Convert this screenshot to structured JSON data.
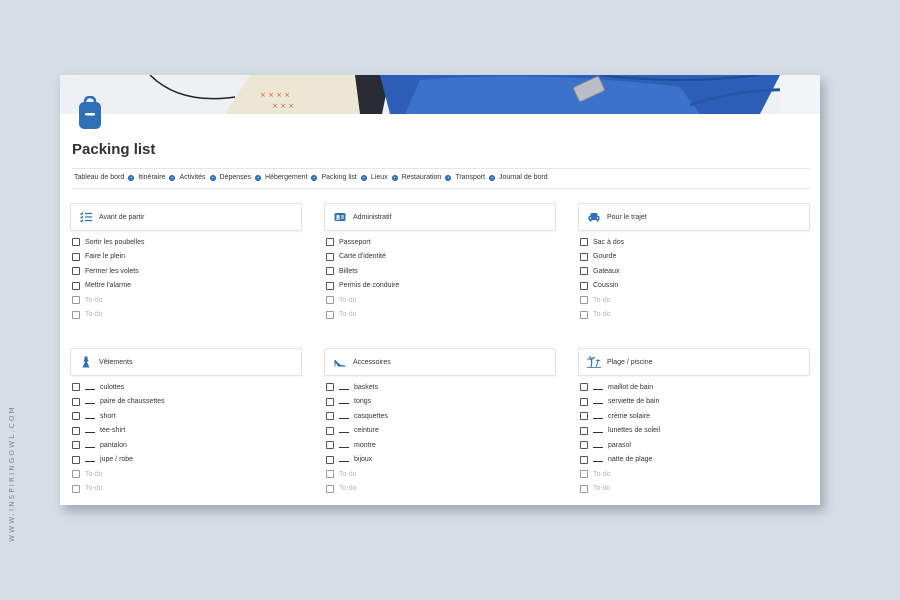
{
  "watermark": "WWW.INSPIRINGOWL.COM",
  "page": {
    "title": "Packing list",
    "icon": "backpack-icon",
    "accent_color": "#2f6fb5"
  },
  "breadcrumbs": [
    "Tableau de bord",
    "Itinéraire",
    "Activités",
    "Dépenses",
    "Hébergement",
    "Packing list",
    "Lieux",
    "Restauration",
    "Transport",
    "Journal de bord"
  ],
  "sections": {
    "avant": {
      "title": "Avant de partir",
      "icon": "checklist-icon",
      "items": [
        "Sortir les poubelles",
        "Faire le plein",
        "Fermer les volets",
        "Mettre l'alarme"
      ],
      "todo": [
        "To-do",
        "To-do"
      ]
    },
    "admin": {
      "title": "Administratif",
      "icon": "id-card-icon",
      "items": [
        "Passeport",
        "Carte d'identité",
        "Billets",
        "Permis de conduire"
      ],
      "todo": [
        "To-do",
        "To-do"
      ]
    },
    "trajet": {
      "title": "Pour le trajet",
      "icon": "car-icon",
      "items": [
        "Sac à dos",
        "Gourde",
        "Gateaux",
        "Coussin"
      ],
      "todo": [
        "To-do",
        "To-do"
      ]
    },
    "vetements": {
      "title": "Vêtements",
      "icon": "dress-icon",
      "items": [
        "culottes",
        "paire de chaussettes",
        "short",
        "tee-shirt",
        "pantalon",
        "jupe / robe"
      ],
      "todo": [
        "To-do",
        "To-do"
      ]
    },
    "accessoires": {
      "title": "Accessoires",
      "icon": "high-heel-icon",
      "items": [
        "baskets",
        "tongs",
        "casquettes",
        "ceinture",
        "montre",
        "bijoux"
      ],
      "todo": [
        "To-do",
        "To-do"
      ]
    },
    "plage": {
      "title": "Plage / piscine",
      "icon": "palm-tree-icon",
      "items": [
        "maillot de bain",
        "serviette de bain",
        "crème solaire",
        "lunettes de soleil",
        "parasol",
        "natte de plage"
      ],
      "todo": [
        "To-do",
        "To-do"
      ]
    }
  }
}
